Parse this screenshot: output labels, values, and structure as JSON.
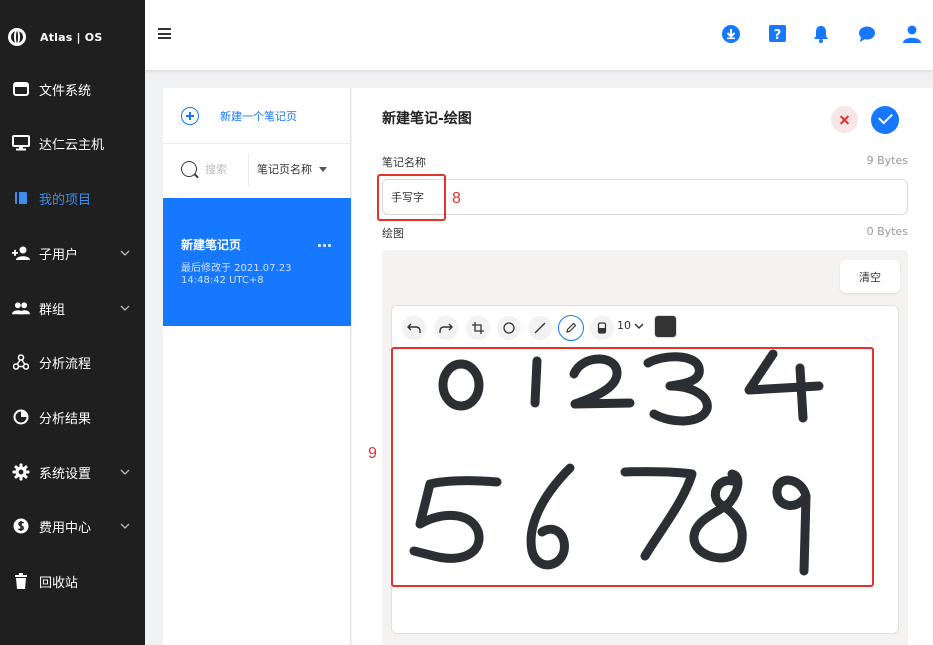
{
  "sidebar": {
    "brand": "Atlas | OS",
    "items": [
      {
        "label": "文件系统",
        "icon": "window-icon",
        "expandable": false
      },
      {
        "label": "达仁云主机",
        "icon": "monitor-icon",
        "expandable": false
      },
      {
        "label": "我的项目",
        "icon": "project-icon",
        "expandable": false,
        "active": true
      },
      {
        "label": "子用户",
        "icon": "add-user-icon",
        "expandable": true
      },
      {
        "label": "群组",
        "icon": "group-icon",
        "expandable": true
      },
      {
        "label": "分析流程",
        "icon": "workflow-icon",
        "expandable": false
      },
      {
        "label": "分析结果",
        "icon": "pie-chart-icon",
        "expandable": false
      },
      {
        "label": "系统设置",
        "icon": "gear-icon",
        "expandable": true
      },
      {
        "label": "费用中心",
        "icon": "dollar-icon",
        "expandable": true
      },
      {
        "label": "回收站",
        "icon": "trash-icon",
        "expandable": false
      }
    ]
  },
  "topbar": {
    "icons": [
      "download-icon",
      "help-icon",
      "bell-icon",
      "chat-icon",
      "user-icon"
    ]
  },
  "notes_panel": {
    "new_note_label": "新建一个笔记页",
    "search_placeholder": "搜索",
    "sort_label": "笔记页名称",
    "notes": [
      {
        "title": "新建笔记页",
        "modified_line1": "最后修改于 2021.07.23",
        "modified_line2": "14:48:42 UTC+8"
      }
    ]
  },
  "editor": {
    "title": "新建笔记-绘图",
    "name_label": "笔记名称",
    "name_size": "9 Bytes",
    "name_value": "手写字",
    "drawing_label": "绘图",
    "drawing_size": "0 Bytes",
    "clear_label": "清空",
    "brush_size": "10",
    "brush_color": "#333333",
    "tools": [
      "undo-icon",
      "redo-icon",
      "crop-icon",
      "circle-icon",
      "line-icon",
      "pen-icon",
      "eraser-icon"
    ],
    "selected_tool": "pen-icon"
  },
  "annotations": {
    "name_marker": "8",
    "drawing_marker": "9"
  },
  "colors": {
    "sidebar_bg": "#1f1f1f",
    "accent": "#1677ff",
    "annotation_red": "#e5322d"
  }
}
